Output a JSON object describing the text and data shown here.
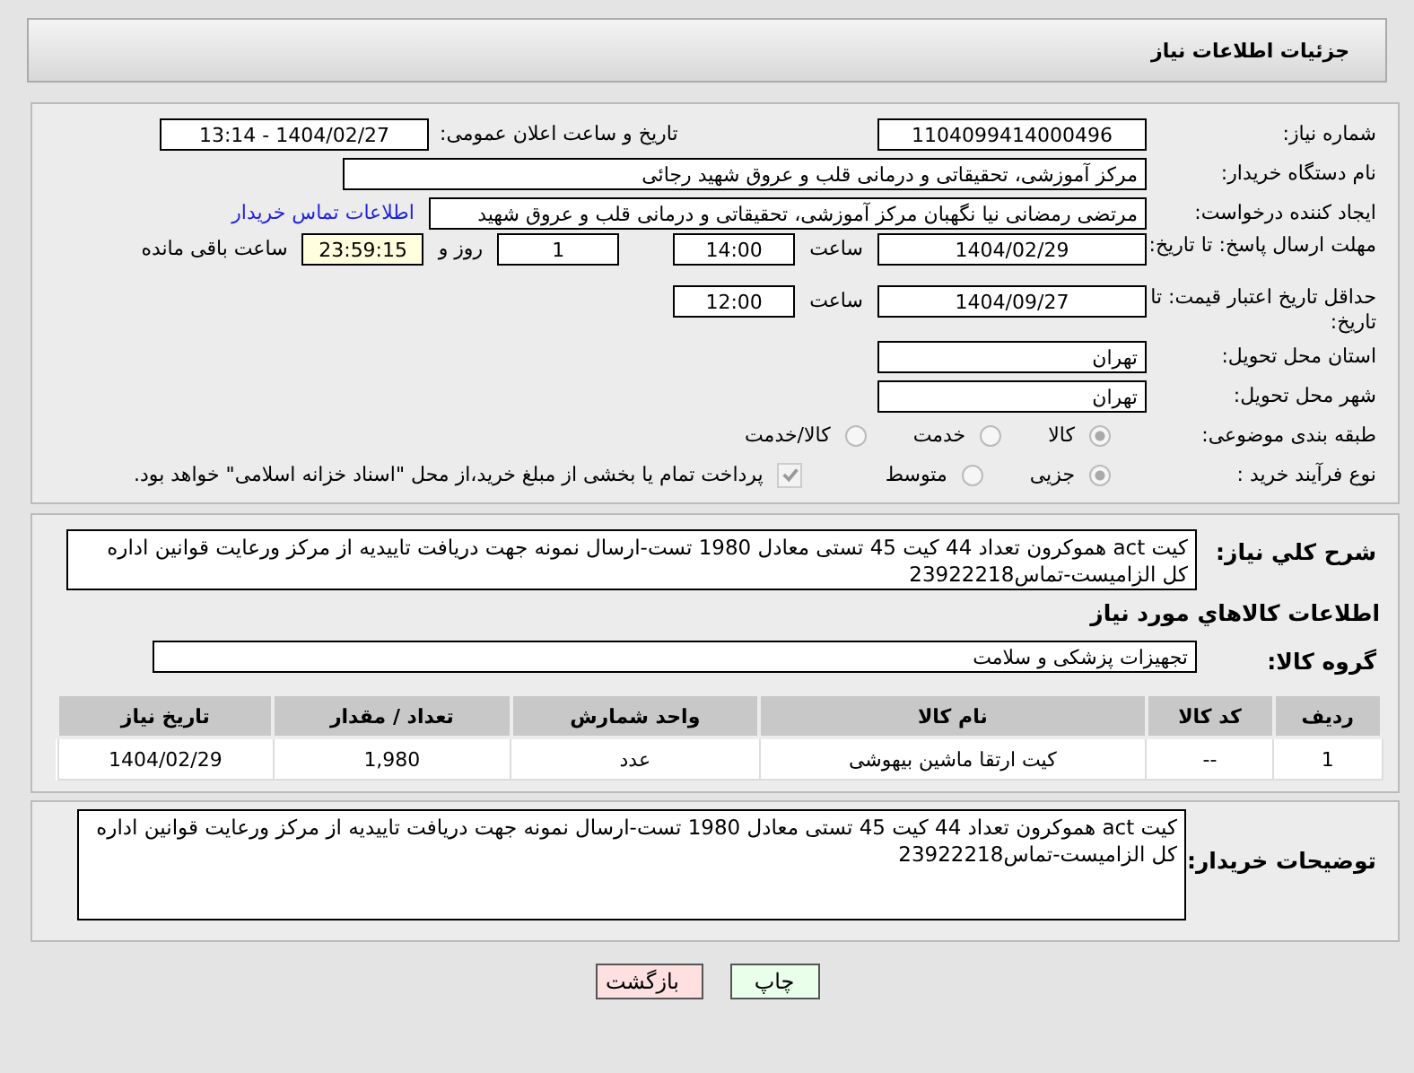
{
  "title": "جزئیات اطلاعات نیاز",
  "need_number": {
    "label": "شماره نیاز:",
    "value": "1104099414000496"
  },
  "announce": {
    "label": "تاریخ و ساعت اعلان عمومی:",
    "value": "1404/02/27 - 13:14"
  },
  "buyer_org": {
    "label": "نام دستگاه خریدار:",
    "value": "مرکز آموزشی، تحقیقاتی و درمانی قلب و عروق شهید رجائی"
  },
  "creator": {
    "label": "ایجاد کننده درخواست:",
    "value": "مرتضی رمضانی نیا نگهبان مرکز آموزشی، تحقیقاتی و درمانی قلب و عروق شهید",
    "link": "اطلاعات تماس خریدار"
  },
  "deadline": {
    "label": "مهلت ارسال پاسخ: تا تاریخ:",
    "date": "1404/02/29",
    "time_label": "ساعت",
    "time": "14:00",
    "days": "1",
    "days_label": "روز و",
    "remaining": "23:59:15",
    "remaining_label": "ساعت باقی مانده"
  },
  "validity": {
    "label": "حداقل تاریخ اعتبار قیمت: تا تاریخ:",
    "date": "1404/09/27",
    "time_label": "ساعت",
    "time": "12:00"
  },
  "province": {
    "label": "استان محل تحویل:",
    "value": "تهران"
  },
  "city": {
    "label": "شهر محل تحویل:",
    "value": "تهران"
  },
  "category": {
    "label": "طبقه بندی موضوعی:",
    "options": [
      {
        "label": "کالا",
        "selected": true
      },
      {
        "label": "خدمت",
        "selected": false
      },
      {
        "label": "کالا/خدمت",
        "selected": false
      }
    ]
  },
  "process": {
    "label": "نوع فرآیند خرید :",
    "options": [
      {
        "label": "جزیی",
        "selected": true
      },
      {
        "label": "متوسط",
        "selected": false
      }
    ],
    "payment": {
      "checked": true,
      "label": "پرداخت تمام یا بخشی از مبلغ خرید،از محل \"اسناد خزانه اسلامی\" خواهد بود."
    }
  },
  "summary": {
    "label": "شرح کلي نياز:",
    "value": "کیت act هموکرون تعداد 44 کیت 45 تستی معادل 1980 تست-ارسال نمونه جهت دریافت تاییدیه از مرکز ورعایت قوانین اداره کل الزامیست-تماس23922218"
  },
  "goods_heading": "اطلاعات کالاهاي مورد نياز",
  "goods_group": {
    "label": "گروه کالا:",
    "value": "تجهیزات پزشکی و سلامت"
  },
  "table": {
    "columns": [
      "ردیف",
      "کد کالا",
      "نام کالا",
      "واحد شمارش",
      "تعداد / مقدار",
      "تاریخ نیاز"
    ],
    "rows": [
      [
        "1",
        "--",
        "کیت ارتقا ماشین بیهوشی",
        "عدد",
        "1,980",
        "1404/02/29"
      ]
    ]
  },
  "notes": {
    "label": "توضیحات خریدار:",
    "value": "کیت act هموکرون تعداد 44 کیت 45 تستی معادل 1980 تست-ارسال نمونه جهت دریافت تاییدیه از مرکز ورعایت قوانین اداره کل الزامیست-تماس23922218"
  },
  "buttons": [
    {
      "label": "چاپ",
      "kind": "print"
    },
    {
      "label": "بازگشت",
      "kind": "back"
    }
  ]
}
